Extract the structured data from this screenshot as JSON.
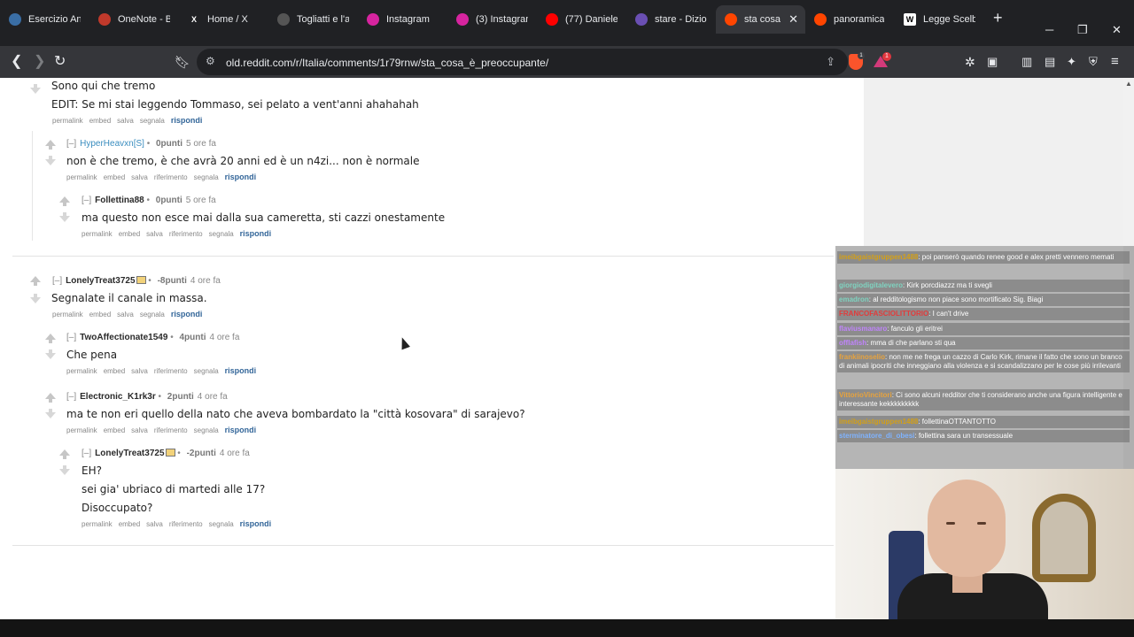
{
  "browser": {
    "tabs": [
      {
        "label": "Esercizio Ana",
        "icon": "moodle-icon",
        "color": "#3a6ea5"
      },
      {
        "label": "OneNote - B",
        "icon": "onenote-icon",
        "color": "#c0392b"
      },
      {
        "label": "Home / X",
        "icon": "x-icon",
        "color": "#000000"
      },
      {
        "label": "Togliatti e l'a",
        "icon": "page-icon",
        "color": "#555555"
      },
      {
        "label": "Instagram",
        "icon": "instagram-icon",
        "color": "#d6249f"
      },
      {
        "label": "(3) Instagram",
        "icon": "instagram-icon",
        "color": "#d6249f"
      },
      {
        "label": "(77) Daniele",
        "icon": "youtube-icon",
        "color": "#ff0000"
      },
      {
        "label": "stare - Dizion",
        "icon": "dictionary-icon",
        "color": "#6a4fb3"
      },
      {
        "label": "sta cosa",
        "icon": "reddit-icon",
        "color": "#ff4500",
        "active": true
      },
      {
        "label": "panoramica",
        "icon": "reddit-icon",
        "color": "#ff4500"
      },
      {
        "label": "Legge Scelba",
        "icon": "wikipedia-icon",
        "color": "#ffffff"
      }
    ],
    "new_tab": "+",
    "url": "old.reddit.com/r/Italia/comments/1r79rnw/sta_cosa_è_preoccupante/",
    "shield_badge": "1",
    "rewards_badge": "1"
  },
  "comments": [
    {
      "body_lines": [
        "Sono qui che tremo",
        "EDIT: Se mi stai leggendo Tommaso, sei pelato a vent'anni ahahahah"
      ],
      "buttons": [
        "permalink",
        "embed",
        "salva",
        "segnala"
      ],
      "reply": "rispondi"
    },
    {
      "expander": "[–]",
      "author": "HyperHeavxn[S]",
      "score": "0punti",
      "time": "5 ore fa",
      "body_lines": [
        "non è che tremo, è che avrà 20 anni ed è un n4zi... non è normale"
      ],
      "buttons": [
        "permalink",
        "embed",
        "salva",
        "riferimento",
        "segnala"
      ],
      "reply": "rispondi"
    },
    {
      "expander": "[–]",
      "author": "Follettina88",
      "score": "0punti",
      "time": "5 ore fa",
      "body_lines": [
        "ma questo non esce mai dalla sua cameretta, sti cazzi onestamente"
      ],
      "buttons": [
        "permalink",
        "embed",
        "salva",
        "riferimento",
        "segnala"
      ],
      "reply": "rispondi"
    },
    {
      "expander": "[–]",
      "author": "LonelyTreat3725",
      "score": "-8punti",
      "time": "4 ore fa",
      "body_lines": [
        "Segnalate il canale in massa."
      ],
      "buttons": [
        "permalink",
        "embed",
        "salva",
        "segnala"
      ],
      "reply": "rispondi"
    },
    {
      "expander": "[–]",
      "author": "TwoAffectionate1549",
      "score": "4punti",
      "time": "4 ore fa",
      "body_lines": [
        "Che pena"
      ],
      "buttons": [
        "permalink",
        "embed",
        "salva",
        "riferimento",
        "segnala"
      ],
      "reply": "rispondi"
    },
    {
      "expander": "[–]",
      "author": "Electronic_K1rk3r",
      "score": "2punti",
      "time": "4 ore fa",
      "body_lines": [
        "ma te non eri quello della nato che aveva bombardato la \"città kosovara\" di sarajevo?"
      ],
      "buttons": [
        "permalink",
        "embed",
        "salva",
        "riferimento",
        "segnala"
      ],
      "reply": "rispondi"
    },
    {
      "expander": "[–]",
      "author": "LonelyTreat3725",
      "score": "-2punti",
      "time": "4 ore fa",
      "body_lines": [
        "EH?",
        "sei gia' ubriaco di martedi alle 17?",
        "Disoccupato?"
      ],
      "buttons": [
        "permalink",
        "embed",
        "salva",
        "riferimento",
        "segnala"
      ],
      "reply": "rispondi"
    }
  ],
  "chat": [
    {
      "user": "imeibgaistgruppen1488",
      "text": ": poi panserò quando renee good e alex pretti vennero memati",
      "color": "#d4a017"
    },
    {
      "user": "giorgiodigitalevero",
      "text": ": Kirk porcdiazzz ma ti svegli",
      "color": "#7fd3c0"
    },
    {
      "user": "emadron",
      "text": ": al redditologismo non piace sono mortificato Sig. Biagi",
      "color": "#7fd3c0"
    },
    {
      "user": "FRANCOFASCIOLITTORIO",
      "text": ": I can't drive",
      "color": "#e23b3b"
    },
    {
      "user": "flaviusmanaro",
      "text": ": fanculo gli eritrei",
      "color": "#c084fc"
    },
    {
      "user": "offlafish",
      "text": ": mma di che parlano sti qua",
      "color": "#c084fc"
    },
    {
      "user": "frankiinoselio",
      "text": ": non me ne frega un cazzo di Carlo Kirk, rimane il fatto che sono un branco di animali ipocriti che inneggiano alla violenza e si scandalizzano per le cose più irrilevanti",
      "color": "#e8a33c"
    },
    {
      "user": "VittorioVincitori",
      "text": ": Ci sono alcuni redditor che ti considerano anche una figura intelligente e interessante kekkkkkkkkk",
      "color": "#e8a33c"
    },
    {
      "user": "imeibgaistgruppen1488",
      "text": ": follettinaOTTANTOTTO",
      "color": "#d4a017"
    },
    {
      "user": "sterminatore_di_obesi",
      "text": ": follettina sara un transessuale",
      "color": "#7fb3ff"
    }
  ]
}
